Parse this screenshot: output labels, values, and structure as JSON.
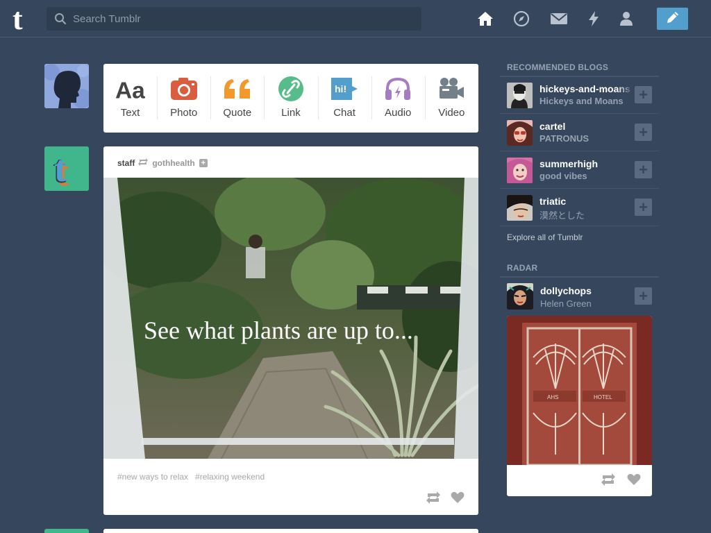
{
  "header": {
    "search_placeholder": "Search Tumblr",
    "nav_icons": [
      "home-icon",
      "explore-compass-icon",
      "inbox-envelope-icon",
      "activity-lightning-icon",
      "account-person-icon"
    ],
    "compose_icon": "pencil-icon"
  },
  "post_types": [
    {
      "label": "Text",
      "icon": "text-aa-icon",
      "color": "#444444"
    },
    {
      "label": "Photo",
      "icon": "camera-icon",
      "color": "#d95e40"
    },
    {
      "label": "Quote",
      "icon": "quote-icon",
      "color": "#f2992e"
    },
    {
      "label": "Link",
      "icon": "link-icon",
      "color": "#56bc8a"
    },
    {
      "label": "Chat",
      "icon": "chat-icon",
      "color": "#529ecc"
    },
    {
      "label": "Audio",
      "icon": "headphones-icon",
      "color": "#a77dc2"
    },
    {
      "label": "Video",
      "icon": "video-camera-icon",
      "color": "#748089"
    }
  ],
  "post": {
    "author": "staff",
    "reblogged_from": "gothhealth",
    "image_caption": "See what plants are up to...",
    "tags": [
      "#new ways to relax",
      "#relaxing weekend"
    ]
  },
  "sidebar": {
    "recommended_title": "RECOMMENDED BLOGS",
    "recommended": [
      {
        "name": "hickeys-and-moans",
        "subtitle": "Hickeys and Moans"
      },
      {
        "name": "cartel",
        "subtitle": "PATRONUS"
      },
      {
        "name": "summerhigh",
        "subtitle": "good vibes"
      },
      {
        "name": "triatic",
        "subtitle": "漠然とした"
      }
    ],
    "explore_link": "Explore all of Tumblr",
    "radar_title": "RADAR",
    "radar": {
      "name": "dollychops",
      "subtitle": "Helen Green",
      "image_text_left": "AHS",
      "image_text_right": "HOTEL"
    }
  },
  "colors": {
    "background": "#36465d",
    "compose_button": "#529ecc",
    "card": "#ffffff"
  }
}
